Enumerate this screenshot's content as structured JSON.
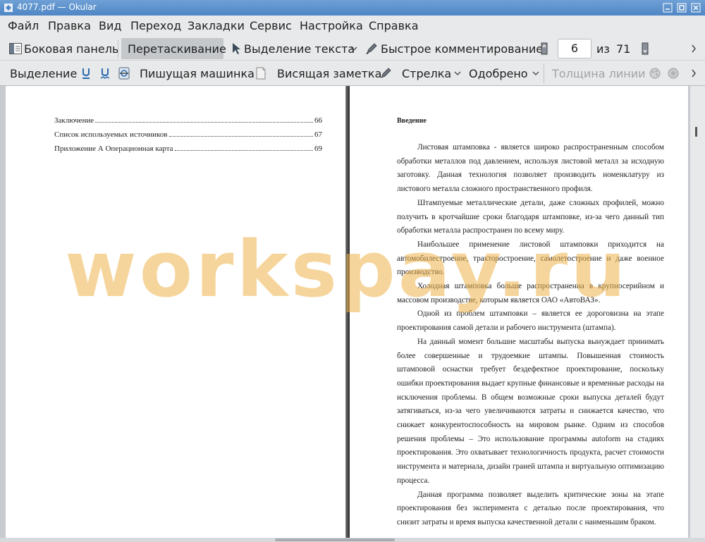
{
  "window": {
    "title": "4077.pdf — Okular"
  },
  "menu": [
    "Файл",
    "Правка",
    "Вид",
    "Переход",
    "Закладки",
    "Сервис",
    "Настройка",
    "Справка"
  ],
  "toolbar1": {
    "sidebar": "Боковая панель",
    "browse": "Перетаскивание",
    "text_select": "Выделение текста",
    "quick_annot": "Быстрое комментирование",
    "page_current": "6",
    "page_of": "из",
    "page_total": "71"
  },
  "toolbar2": {
    "highlight": "Выделение",
    "typewriter": "Пишущая машинка",
    "note": "Висящая заметка",
    "arrow": "Стрелка",
    "stamp": "Одобрено",
    "line_width": "Толщина линии"
  },
  "left_page": {
    "toc": [
      {
        "title": "Заключение",
        "page": "66"
      },
      {
        "title": "Список используемых источников",
        "page": "67"
      },
      {
        "title": "Приложение А Операционная карта",
        "page": "69"
      }
    ]
  },
  "right_page": {
    "heading": "Введение",
    "paragraphs": [
      "Листовая штамповка - является широко распространенным способом обработки металлов под давлением, используя листовой металл за исходную заготовку. Данная технология позволяет производить номенклатуру из листового металла сложного пространственного профиля.",
      "Штампуемые металлические детали, даже сложных профилей, можно получить в кротчайшие сроки благодаря штамповке, из-за чего данный тип обработки металла распространен по всему миру.",
      "Наибольшее применение листовой штамповки приходится на автомобилестроение, тракторостроение, самолетостроение и даже военное производство.",
      "Холодная штамповка больше распространенна в крупносерийном и массовом производстве, которым является ОАО «АвтоВАЗ».",
      "Одной из проблем штамповки – является ее дороговизна на этапе проектирования самой детали и рабочего инструмента (штампа).",
      "На данный момент большие масштабы выпуска вынуждает принимать более совершенные и трудоемкие штампы. Повышенная стоимость штамповой оснастки требует бездефектное проектирование, поскольку ошибки проектирования выдает крупные финансовые и временные расходы на исключения проблемы. В общем возможные сроки выпуска деталей будут затягиваться, из-за чего увеличиваются затраты и снижается качество, что снижает конкурентоспособность на мировом рынке. Одним из способов решения проблемы – Это использование программы autoform на стадиях проектирования. Это охватывает технологичность продукта, расчет стоимости инструмента и материала, дизайн граней штампа и виртуальную оптимизацию процесса.",
      "Данная программа позволяет выделить критические зоны на этапе проектирования без эксперимента с деталью после проектирования, что снизит затраты и время выпуска качественной детали с наименьшим браком."
    ]
  },
  "watermark": "workspay.ru",
  "icons": {
    "sidebar": "sidebar-icon",
    "text_select": "cursor-icon",
    "quick_annot": "pen-icon",
    "page_prev": "page-up-icon",
    "page_next": "page-down-icon"
  }
}
